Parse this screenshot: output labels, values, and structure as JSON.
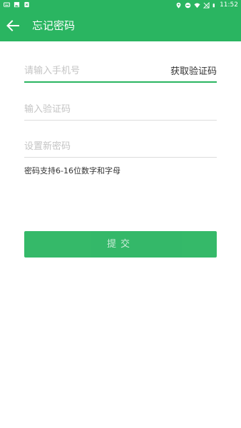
{
  "status_bar": {
    "time": "11:52",
    "left_icons": [
      "keyboard-icon",
      "image-icon",
      "app-notification-icon"
    ],
    "right_icons": [
      "location-icon",
      "do-not-disturb-icon",
      "wifi-icon",
      "no-signal-icon",
      "battery-icon"
    ]
  },
  "app_bar": {
    "title": "忘记密码",
    "back_icon": "arrow-left-icon"
  },
  "form": {
    "phone": {
      "placeholder": "请输入手机号",
      "value": ""
    },
    "get_code_label": "获取验证码",
    "code": {
      "placeholder": "输入验证码",
      "value": ""
    },
    "new_password": {
      "placeholder": "设置新密码",
      "value": ""
    },
    "hint": "密码支持6-16位数字和字母",
    "submit_label": "提交"
  },
  "colors": {
    "primary": "#2ab561",
    "text": "#333333",
    "placeholder": "#c4c4c4",
    "divider": "#dcdcdc"
  }
}
